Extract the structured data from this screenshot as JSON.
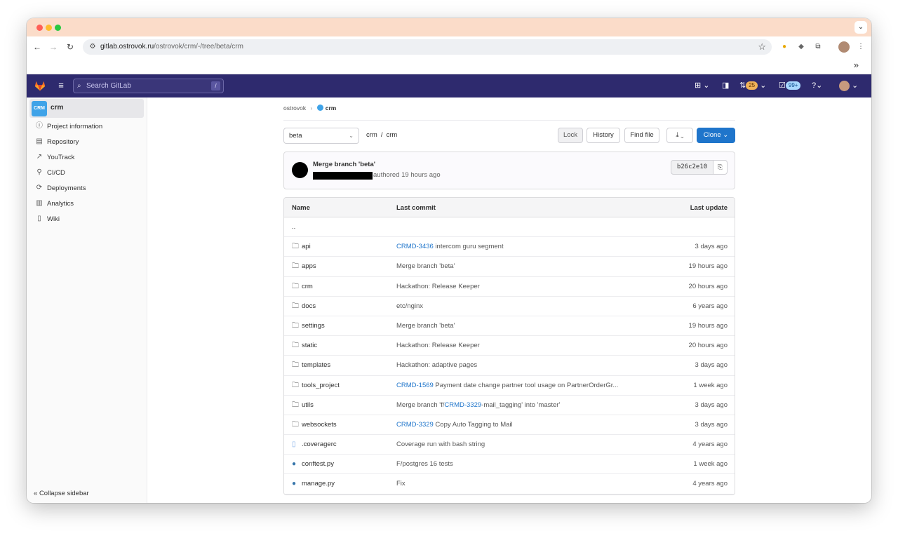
{
  "browser": {
    "url_host": "gitlab.ostrovok.ru",
    "url_path": "/ostrovok/crm/-/tree/beta/crm",
    "tab_dropdown": "⌄",
    "bookmarks_more": "»"
  },
  "header": {
    "search_placeholder": "Search GitLab",
    "search_shortcut": "/",
    "merge_requests_count": "25",
    "todos_count": "99+"
  },
  "sidebar": {
    "project_name": "crm",
    "project_avatar_text": "CRM",
    "items": [
      {
        "label": "Project information",
        "icon": "info-icon"
      },
      {
        "label": "Repository",
        "icon": "document-icon"
      },
      {
        "label": "YouTrack",
        "icon": "external-link-icon"
      },
      {
        "label": "CI/CD",
        "icon": "rocket-icon"
      },
      {
        "label": "Deployments",
        "icon": "deployments-icon"
      },
      {
        "label": "Analytics",
        "icon": "chart-icon"
      },
      {
        "label": "Wiki",
        "icon": "book-icon"
      }
    ],
    "collapse_label": "Collapse sidebar"
  },
  "breadcrumb": {
    "group": "ostrovok",
    "project": "crm"
  },
  "toolbar": {
    "branch": "beta",
    "path_root": "crm",
    "path_dir": "crm",
    "lock_label": "Lock",
    "history_label": "History",
    "find_file_label": "Find file",
    "clone_label": "Clone"
  },
  "last_commit": {
    "title": "Merge branch 'beta'",
    "meta": "authored 19 hours ago",
    "sha": "b26c2e10"
  },
  "table": {
    "headers": {
      "name": "Name",
      "last_commit": "Last commit",
      "last_update": "Last update"
    },
    "parent_label": "..",
    "rows": [
      {
        "name": "api",
        "type": "folder",
        "commit_link": "CRMD-3436",
        "commit_prefix": "",
        "commit_text": " intercom guru segment",
        "updated": "3 days ago"
      },
      {
        "name": "apps",
        "type": "folder",
        "commit_link": "",
        "commit_prefix": "",
        "commit_text": "Merge branch 'beta'",
        "updated": "19 hours ago"
      },
      {
        "name": "crm",
        "type": "folder",
        "commit_link": "",
        "commit_prefix": "",
        "commit_text": "Hackathon: Release Keeper",
        "updated": "20 hours ago"
      },
      {
        "name": "docs",
        "type": "folder",
        "commit_link": "",
        "commit_prefix": "",
        "commit_text": "etc/nginx",
        "updated": "6 years ago"
      },
      {
        "name": "settings",
        "type": "folder",
        "commit_link": "",
        "commit_prefix": "",
        "commit_text": "Merge branch 'beta'",
        "updated": "19 hours ago"
      },
      {
        "name": "static",
        "type": "folder",
        "commit_link": "",
        "commit_prefix": "",
        "commit_text": "Hackathon: Release Keeper",
        "updated": "20 hours ago"
      },
      {
        "name": "templates",
        "type": "folder",
        "commit_link": "",
        "commit_prefix": "",
        "commit_text": "Hackathon: adaptive pages",
        "updated": "3 days ago"
      },
      {
        "name": "tools_project",
        "type": "folder",
        "commit_link": "CRMD-1569",
        "commit_prefix": "",
        "commit_text": " Payment date change partner tool usage on PartnerOrderGr...",
        "updated": "1 week ago"
      },
      {
        "name": "utils",
        "type": "folder",
        "commit_link": "CRMD-3329",
        "commit_prefix": "Merge branch 'f/",
        "commit_text": "-mail_tagging' into 'master'",
        "updated": "3 days ago"
      },
      {
        "name": "websockets",
        "type": "folder",
        "commit_link": "CRMD-3329",
        "commit_prefix": "",
        "commit_text": " Copy Auto Tagging to Mail",
        "updated": "3 days ago"
      },
      {
        "name": ".coveragerc",
        "type": "doc",
        "commit_link": "",
        "commit_prefix": "",
        "commit_text": "Coverage run with bash string",
        "updated": "4 years ago"
      },
      {
        "name": "conftest.py",
        "type": "python",
        "commit_link": "",
        "commit_prefix": "",
        "commit_text": "F/postgres 16 tests",
        "updated": "1 week ago"
      },
      {
        "name": "manage.py",
        "type": "python",
        "commit_link": "",
        "commit_prefix": "",
        "commit_text": "Fix",
        "updated": "4 years ago"
      }
    ]
  },
  "colors": {
    "header_bg": "#2e2a6e",
    "primary_button": "#1f75cb",
    "link": "#1f75cb",
    "titlebar": "#fbdcc9"
  }
}
